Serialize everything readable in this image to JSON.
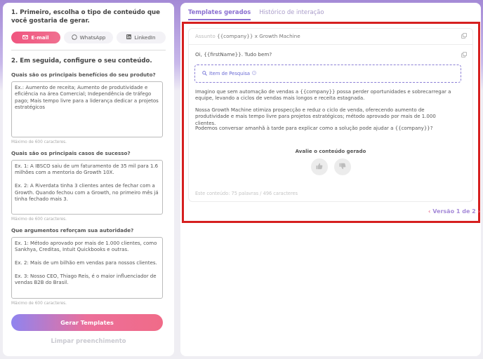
{
  "left": {
    "step1_title": "1. Primeiro, escolha o tipo de conteúdo que você gostaria de gerar.",
    "channels": [
      {
        "label": "E-mail",
        "icon": "mail-icon",
        "active": true
      },
      {
        "label": "WhatsApp",
        "icon": "whatsapp-icon",
        "active": false
      },
      {
        "label": "LinkedIn",
        "icon": "linkedin-icon",
        "active": false
      }
    ],
    "step2_title": "2. Em seguida, configure o seu conteúdo.",
    "questions": [
      {
        "label": "Quais são os principais benefícios do seu produto?",
        "value": "Ex.: Aumento de receita; Aumento de produtividade e eficiência na área Comercial; Independência de tráfego pago; Mais tempo livre para a liderança dedicar a projetos estratégicos",
        "hint": "Máximo de 600 caracteres."
      },
      {
        "label": "Quais são os principais casos de sucesso?",
        "value": "Ex. 1: A IBSCO saiu de um faturamento de 35 mil para 1.6 milhões com a mentoria do Growth 10X.\n\nEx. 2: A Riverdata tinha 3 clientes antes de fechar com a Growth. Quando fechou com a Growth, no primeiro mês já tinha fechado mais 3.",
        "hint": "Máximo de 600 caracteres."
      },
      {
        "label": "Que argumentos reforçam sua autoridade?",
        "value": "Ex. 1: Método aprovado por mais de 1.000 clientes, como Sankhya, Creditas, Intuit Quickbooks e outras.\n\nEx. 2: Mais de um bilhão em vendas para nossos clientes.\n\nEx. 3: Nosso CEO, Thiago Reis, é o maior influenciador de vendas B2B do Brasil.",
        "hint": "Máximo de 600 caracteres."
      }
    ],
    "generate_label": "Gerar Templates",
    "clear_label": "Limpar preenchimento"
  },
  "right": {
    "tabs": [
      {
        "label": "Templates gerados",
        "active": true
      },
      {
        "label": "Histórico de interação",
        "active": false
      }
    ],
    "subject_label": "Assunto",
    "subject_text": "{{company}} x Growth Machine",
    "greeting": "Oi, {{firstName}}. Tudo bem?",
    "research_label": "Item de Pesquisa",
    "paragraphs": [
      "Imagino que sem automação de vendas a {{company}} possa perder oportunidades e sobrecarregar a equipe, levando a ciclos de vendas mais longos e receita estagnada.",
      "Nossa Growth Machine otimiza prospecção e reduz o ciclo de venda, oferecendo aumento de produtividade e mais tempo livre para projetos estratégicos; método aprovado por mais de 1.000 clientes.",
      "Podemos conversar amanhã à tarde para explicar como a solução pode ajudar a {{company}}?"
    ],
    "rate_title": "Avalie o conteúdo gerado",
    "stats": "Este conteúdo: 75 palavras / 496 caracteres",
    "version": "Versão 1 de 2"
  },
  "colors": {
    "accent_purple": "#8a6fd1",
    "accent_pink": "#f0557f",
    "highlight_red": "#d61f1f"
  }
}
